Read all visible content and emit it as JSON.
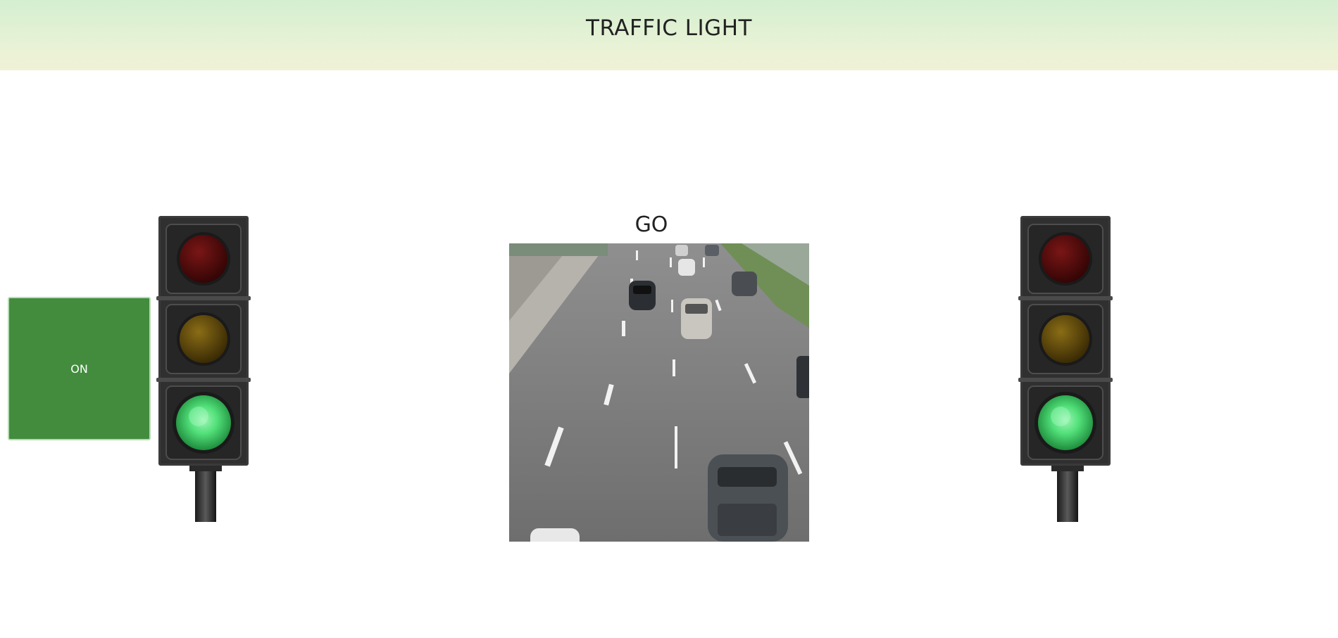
{
  "header": {
    "title": "TRAFFIC LIGHT"
  },
  "toggle": {
    "label": "ON"
  },
  "status": {
    "label": "GO"
  },
  "lights": {
    "active": "green",
    "colors": {
      "red_off": "#5a0c0c",
      "yellow_off": "#6a5410",
      "green_on": "#52e07a",
      "toggle_bg": "#438c3e"
    }
  },
  "icons": [
    "traffic-light-left-icon",
    "traffic-light-right-icon",
    "road-scene-image"
  ]
}
